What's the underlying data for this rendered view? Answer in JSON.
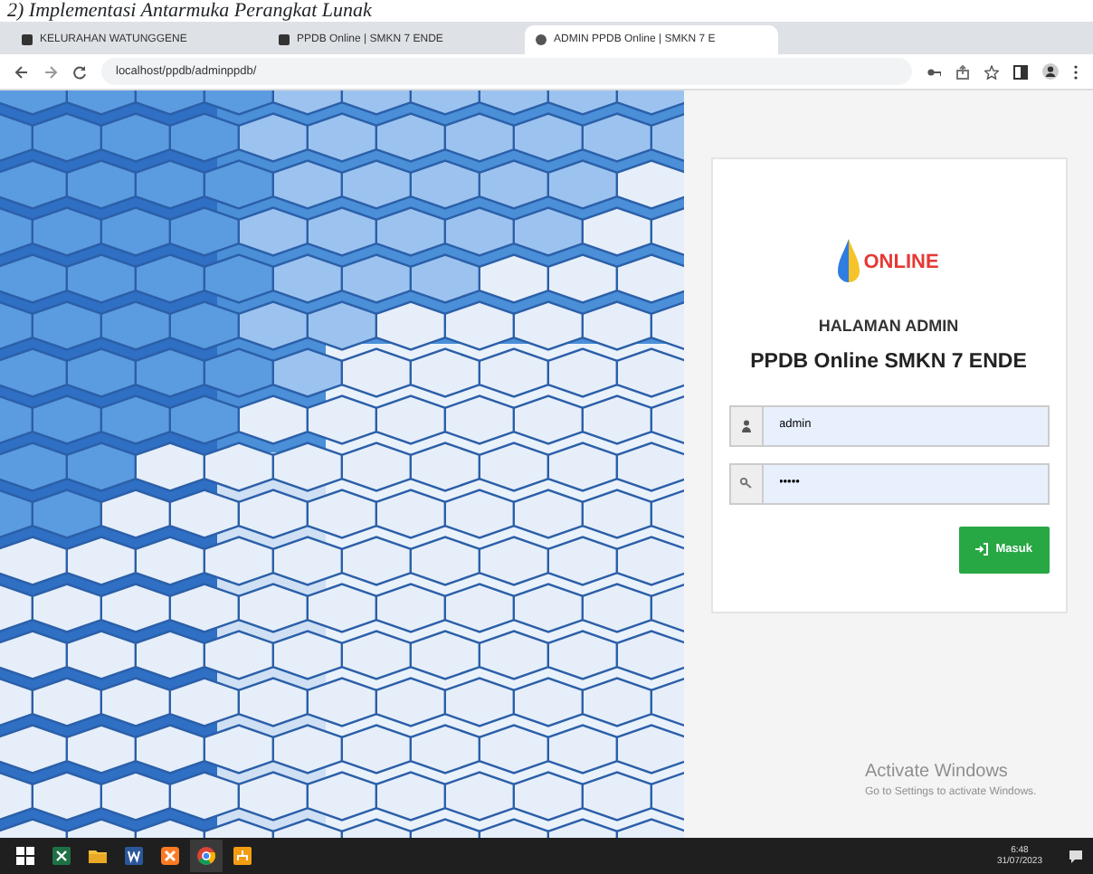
{
  "caption": "2) Implementasi Antarmuka Perangkat Lunak",
  "tabs": [
    {
      "title": "KELURAHAN WATUNGGENE",
      "selected": false
    },
    {
      "title": "PPDB Online | SMKN 7 ENDE",
      "selected": false
    },
    {
      "title": "ADMIN PPDB Online | SMKN 7 E",
      "selected": true
    }
  ],
  "address": "localhost/ppdb/adminppdb/",
  "login": {
    "logo_text": "ONLINE",
    "heading": "HALAMAN ADMIN",
    "title": "PPDB Online SMKN 7 ENDE",
    "fields": [
      {
        "kind": "user",
        "value": "admin"
      },
      {
        "kind": "password",
        "value": "•••••"
      }
    ],
    "button": "Masuk"
  },
  "activation": {
    "title": "Activate Windows",
    "text": "Go to Settings to activate Windows."
  },
  "taskbar": {
    "apps": [
      {
        "kind": "excel"
      },
      {
        "kind": "folder"
      },
      {
        "kind": "word"
      },
      {
        "kind": "xampp"
      },
      {
        "kind": "chrome",
        "selected": true
      },
      {
        "kind": "network"
      }
    ],
    "time": "6:48",
    "date": "31/07/2023"
  }
}
